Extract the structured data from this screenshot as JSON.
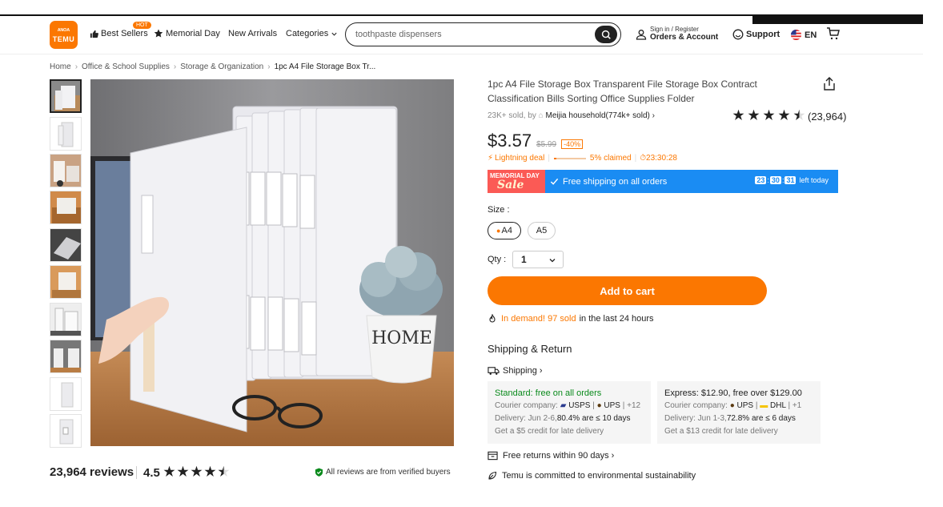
{
  "header": {
    "logo_line1": "ᴬᴺᴼᴬ",
    "logo_line2": "TEMU",
    "best_sellers": "Best Sellers",
    "hot_badge": "HOT",
    "memorial_day": "Memorial Day",
    "new_arrivals": "New Arrivals",
    "categories": "Categories",
    "search_value": "toothpaste dispensers",
    "signin_line1": "Sign in / Register",
    "signin_line2": "Orders & Account",
    "support": "Support",
    "lang": "EN"
  },
  "breadcrumb": [
    "Home",
    "Office & School Supplies",
    "Storage & Organization",
    "1pc A4 File Storage Box Tr..."
  ],
  "reviews": {
    "count": "23,964 reviews",
    "rating": "4.5",
    "verified": "All reviews are from verified buyers"
  },
  "product": {
    "title": "1pc A4 File Storage Box Transparent File Storage Box Contract Classification Bills Sorting Office Supplies Folder",
    "sold": "23K+ sold, by",
    "seller": "Meijia household(774k+ sold)",
    "rating_count": "(23,964)",
    "rating_value": 4.5,
    "price": "$3.57",
    "old_price": "$5.99",
    "discount": "-40%",
    "deal_label": "Lightning deal",
    "claimed": "5% claimed",
    "claimed_fraction": 0.05,
    "deal_timer": "⏱23:30:28",
    "promo_badge_top": "MEMORIAL DAY",
    "promo_badge_main": "Sale",
    "promo_text": "Free shipping on all orders",
    "timer_h": "23",
    "timer_m": "30",
    "timer_s": "31",
    "timer_suffix": "left today",
    "size_label": "Size :",
    "size_options": [
      "A4",
      "A5"
    ],
    "qty_label": "Qty :",
    "qty_value": "1",
    "add_to_cart": "Add to cart",
    "demand_hl": "In demand! 97 sold",
    "demand_rest": "in the last 24 hours"
  },
  "shipping": {
    "title": "Shipping & Return",
    "link": "Shipping",
    "standard": {
      "heading": "Standard: free on all orders",
      "courier_label": "Courier company:",
      "c1": "USPS",
      "c2": "UPS",
      "c_more": "+12",
      "delivery_label": "Delivery: Jun 2-6,",
      "delivery_stat": "80.4% are ≤ 10 days",
      "credit": "Get a $5 credit for late delivery"
    },
    "express": {
      "heading": "Express: $12.90, free over $129.00",
      "courier_label": "Courier company:",
      "c1": "UPS",
      "c2": "DHL",
      "c_more": "+1",
      "delivery_label": "Delivery: Jun 1-3,",
      "delivery_stat": "72.8% are ≤ 6 days",
      "credit": "Get a $13 credit for late delivery"
    },
    "returns": "Free returns within 90 days",
    "eco": "Temu is committed to environmental sustainability"
  },
  "colors": {
    "brand": "#fb7701",
    "promo": "#1a8cf3",
    "verified": "#0a8a1c"
  }
}
